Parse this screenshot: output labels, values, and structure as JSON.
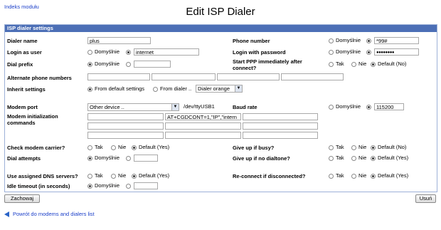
{
  "header": {
    "module_index_link": "Indeks modułu",
    "title": "Edit ISP Dialer"
  },
  "panel": {
    "title": "ISP dialer settings"
  },
  "labels": {
    "dialer_name": "Dialer name",
    "login_as_user": "Login as user",
    "dial_prefix": "Dial prefix",
    "alt_phone": "Alternate phone numbers",
    "inherit": "Inherit settings",
    "modem_port": "Modem port",
    "modem_init": "Modem initialization commands",
    "check_carrier": "Check modem carrier?",
    "dial_attempts": "Dial attempts",
    "use_dns": "Use assigned DNS servers?",
    "idle_timeout": "Idle timeout (in seconds)",
    "phone_number": "Phone number",
    "login_password": "Login with password",
    "start_ppp": "Start PPP immediately after connect?",
    "baud_rate": "Baud rate",
    "give_up_busy": "Give up if busy?",
    "give_up_dialtone": "Give up if no dialtone?",
    "reconnect": "Re-connect if disconnected?"
  },
  "options": {
    "default": "Domyślnie",
    "yes": "Tak",
    "no": "Nie",
    "default_no": "Default (No)",
    "default_yes": "Default (Yes)",
    "from_default": "From default settings",
    "from_dialer": "From dialer .."
  },
  "values": {
    "dialer_name": "plus",
    "login_user": "internet",
    "phone_number": "*99#",
    "password_mask": "●●●●●●●●",
    "inherit_dialer": "Dialer orange",
    "modem_port_select": "Other device ..",
    "modem_port_path": "/dev/ttyUSB1",
    "modem_init_2": "AT+CGDCONT=1,\"IP\",\"intern",
    "baud_rate": "115200"
  },
  "buttons": {
    "save": "Zachowaj",
    "delete": "Usuń"
  },
  "footer": {
    "back_link": "Powrót do modems and dialers list"
  },
  "colors": {
    "panel_header": "#4c6fb6",
    "link": "#1a3ec9"
  }
}
